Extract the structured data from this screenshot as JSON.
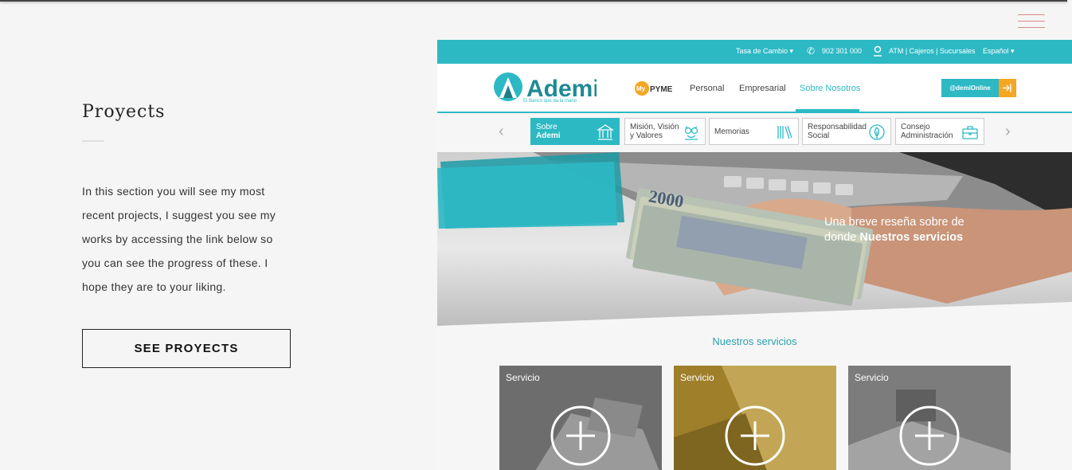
{
  "header": {
    "menu_icon": "hamburger-icon",
    "accent": "#d98b8b"
  },
  "intro": {
    "title": "Proyects",
    "description": "In this section you will see my most recent projects, I suggest you see my works by accessing the link below so you can see the progress of these. I hope they are to your liking.",
    "button_label": "SEE PROYECTS"
  },
  "preview": {
    "accent": "#2cb9c4",
    "topbar": {
      "exchange": "Tasa de Cambio",
      "phone": "902 301 000",
      "atm": "ATM | Cajeros | Sucursales",
      "language": "Español"
    },
    "logo": {
      "name": "Ademi",
      "tagline": "El Banco que da la mano"
    },
    "nav": {
      "mypyme_my": "My",
      "mypyme_pyme": "PYME",
      "items": [
        "Personal",
        "Empresarial",
        "Sobre Nosotros"
      ],
      "online": "@demiOnline"
    },
    "subnav": [
      {
        "l1": "Sobre",
        "l2": "Ademi",
        "icon": "bank-icon"
      },
      {
        "l1": "Misión, Visión",
        "l2": "y Valores",
        "icon": "owl-icon"
      },
      {
        "l1": "Memorias",
        "l2": "",
        "icon": "books-icon"
      },
      {
        "l1": "Responsabilidad",
        "l2": "Social",
        "icon": "leaf-icon"
      },
      {
        "l1": "Consejo",
        "l2": "Administración",
        "icon": "briefcase-icon"
      }
    ],
    "hero": {
      "line1": "Una breve reseña sobre de",
      "line2_a": "donde ",
      "line2_b": "Nuestros servicios",
      "banknote": "2000"
    },
    "services_title": "Nuestros servicios",
    "cards": [
      {
        "label": "Servicio",
        "tone": "#7a7a7a"
      },
      {
        "label": "Servicio",
        "tone": "#a8862a"
      },
      {
        "label": "Servicio",
        "tone": "#8a8a8a"
      }
    ]
  }
}
